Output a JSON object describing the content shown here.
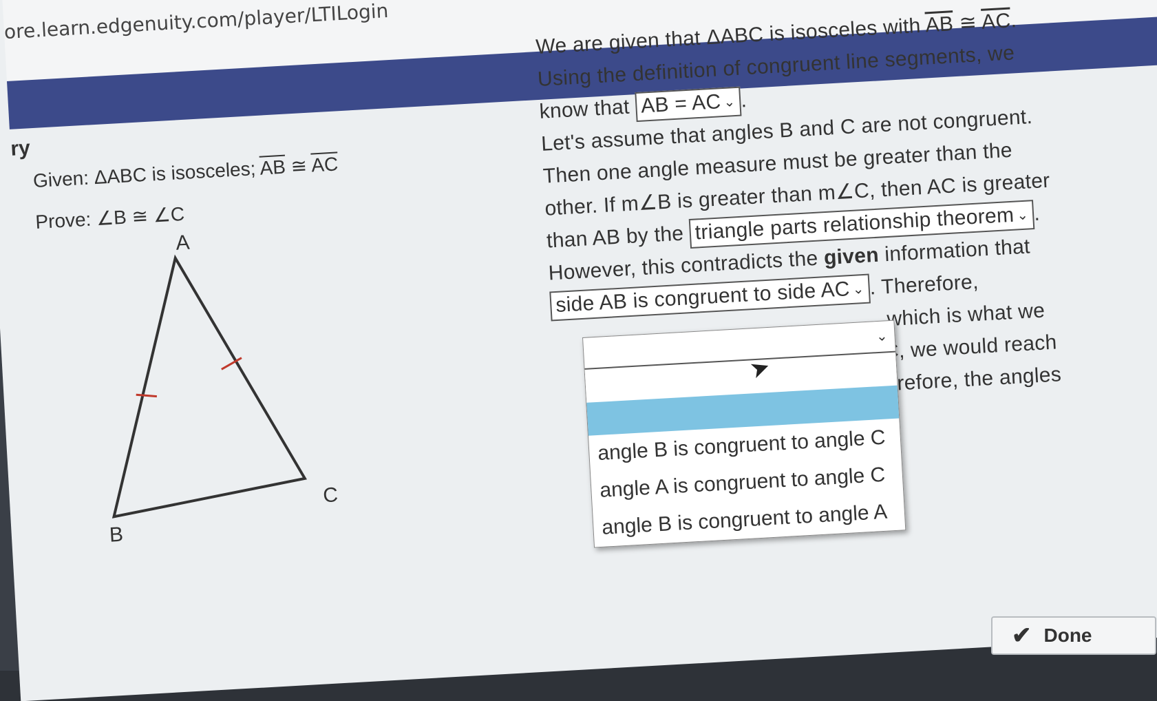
{
  "browser": {
    "url": "ore.learn.edgenuity.com/player/LTILogin"
  },
  "nav": {
    "partial_text": "ry"
  },
  "given": {
    "prefix": "Given: ΔABC is isosceles; ",
    "seg1": "AB",
    "cong": " ≅ ",
    "seg2": "AC"
  },
  "prove": {
    "label": "Prove:",
    "statement": "∠B ≅ ∠C"
  },
  "triangle": {
    "vertex_a": "A",
    "vertex_b": "B",
    "vertex_c": "C"
  },
  "proof": {
    "l1_text": "We are given that ΔABC is isosceles with ",
    "l1_seg1": "AB",
    "l1_cong": " ≅ ",
    "l1_seg2": "AC",
    "l1_end": ".",
    "l2": "Using the definition of congruent line segments, we",
    "l3_pre": "know that ",
    "dropdown1_value": "AB = AC",
    "l3_post": ".",
    "l4": "Let's assume that angles B and C are not congruent.",
    "l5": "Then one angle measure must be greater than the",
    "l6_pre": "other. If m∠B is greater than m∠C, then AC is greater",
    "l7_pre": "than AB by the ",
    "dropdown2_value": "triangle parts relationship theorem",
    "l7_post": ".",
    "l8_pre": "However, this contradicts the ",
    "l8_bold": "given",
    "l8_post": " information that",
    "dropdown3_value": "side AB is congruent to side AC",
    "l9_post": ". Therefore,",
    "l10_post": ", which is what we",
    "l11_partial": "C, we would reach",
    "l12_partial": "erefore, the angles"
  },
  "dropdown_list": {
    "header": "",
    "options": [
      "angle B is congruent to angle C",
      "angle A is congruent to angle C",
      "angle B is congruent to angle A"
    ]
  },
  "done_button": {
    "label": "Done",
    "icon": "checkmark-icon"
  }
}
